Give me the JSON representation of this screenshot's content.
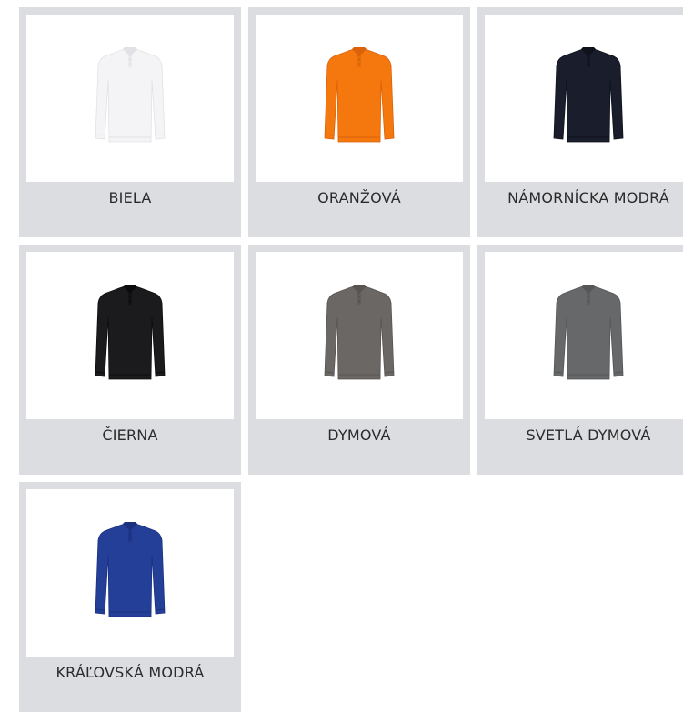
{
  "colors": [
    {
      "label": "BIELA",
      "shirt_color": "#f4f4f6",
      "shade": "#e2e2e6",
      "icon": "polo-shirt-white-icon"
    },
    {
      "label": "ORANŽOVÁ",
      "shirt_color": "#f5780f",
      "shade": "#d9620a",
      "icon": "polo-shirt-orange-icon"
    },
    {
      "label": "NÁMORNÍCKA MODRÁ",
      "shirt_color": "#1a1d2b",
      "shade": "#0f111b",
      "icon": "polo-shirt-navy-icon"
    },
    {
      "label": "ČIERNA",
      "shirt_color": "#1b1b1d",
      "shade": "#0c0c0d",
      "icon": "polo-shirt-black-icon"
    },
    {
      "label": "DYMOVÁ",
      "shirt_color": "#6b6765",
      "shade": "#585452",
      "icon": "polo-shirt-smoke-icon"
    },
    {
      "label": "SVETLÁ DYMOVÁ",
      "shirt_color": "#66686a",
      "shade": "#545658",
      "icon": "polo-shirt-light-smoke-icon"
    },
    {
      "label": "KRÁĽOVSKÁ MODRÁ",
      "shirt_color": "#243f98",
      "shade": "#1b3180",
      "icon": "polo-shirt-royal-blue-icon"
    }
  ]
}
